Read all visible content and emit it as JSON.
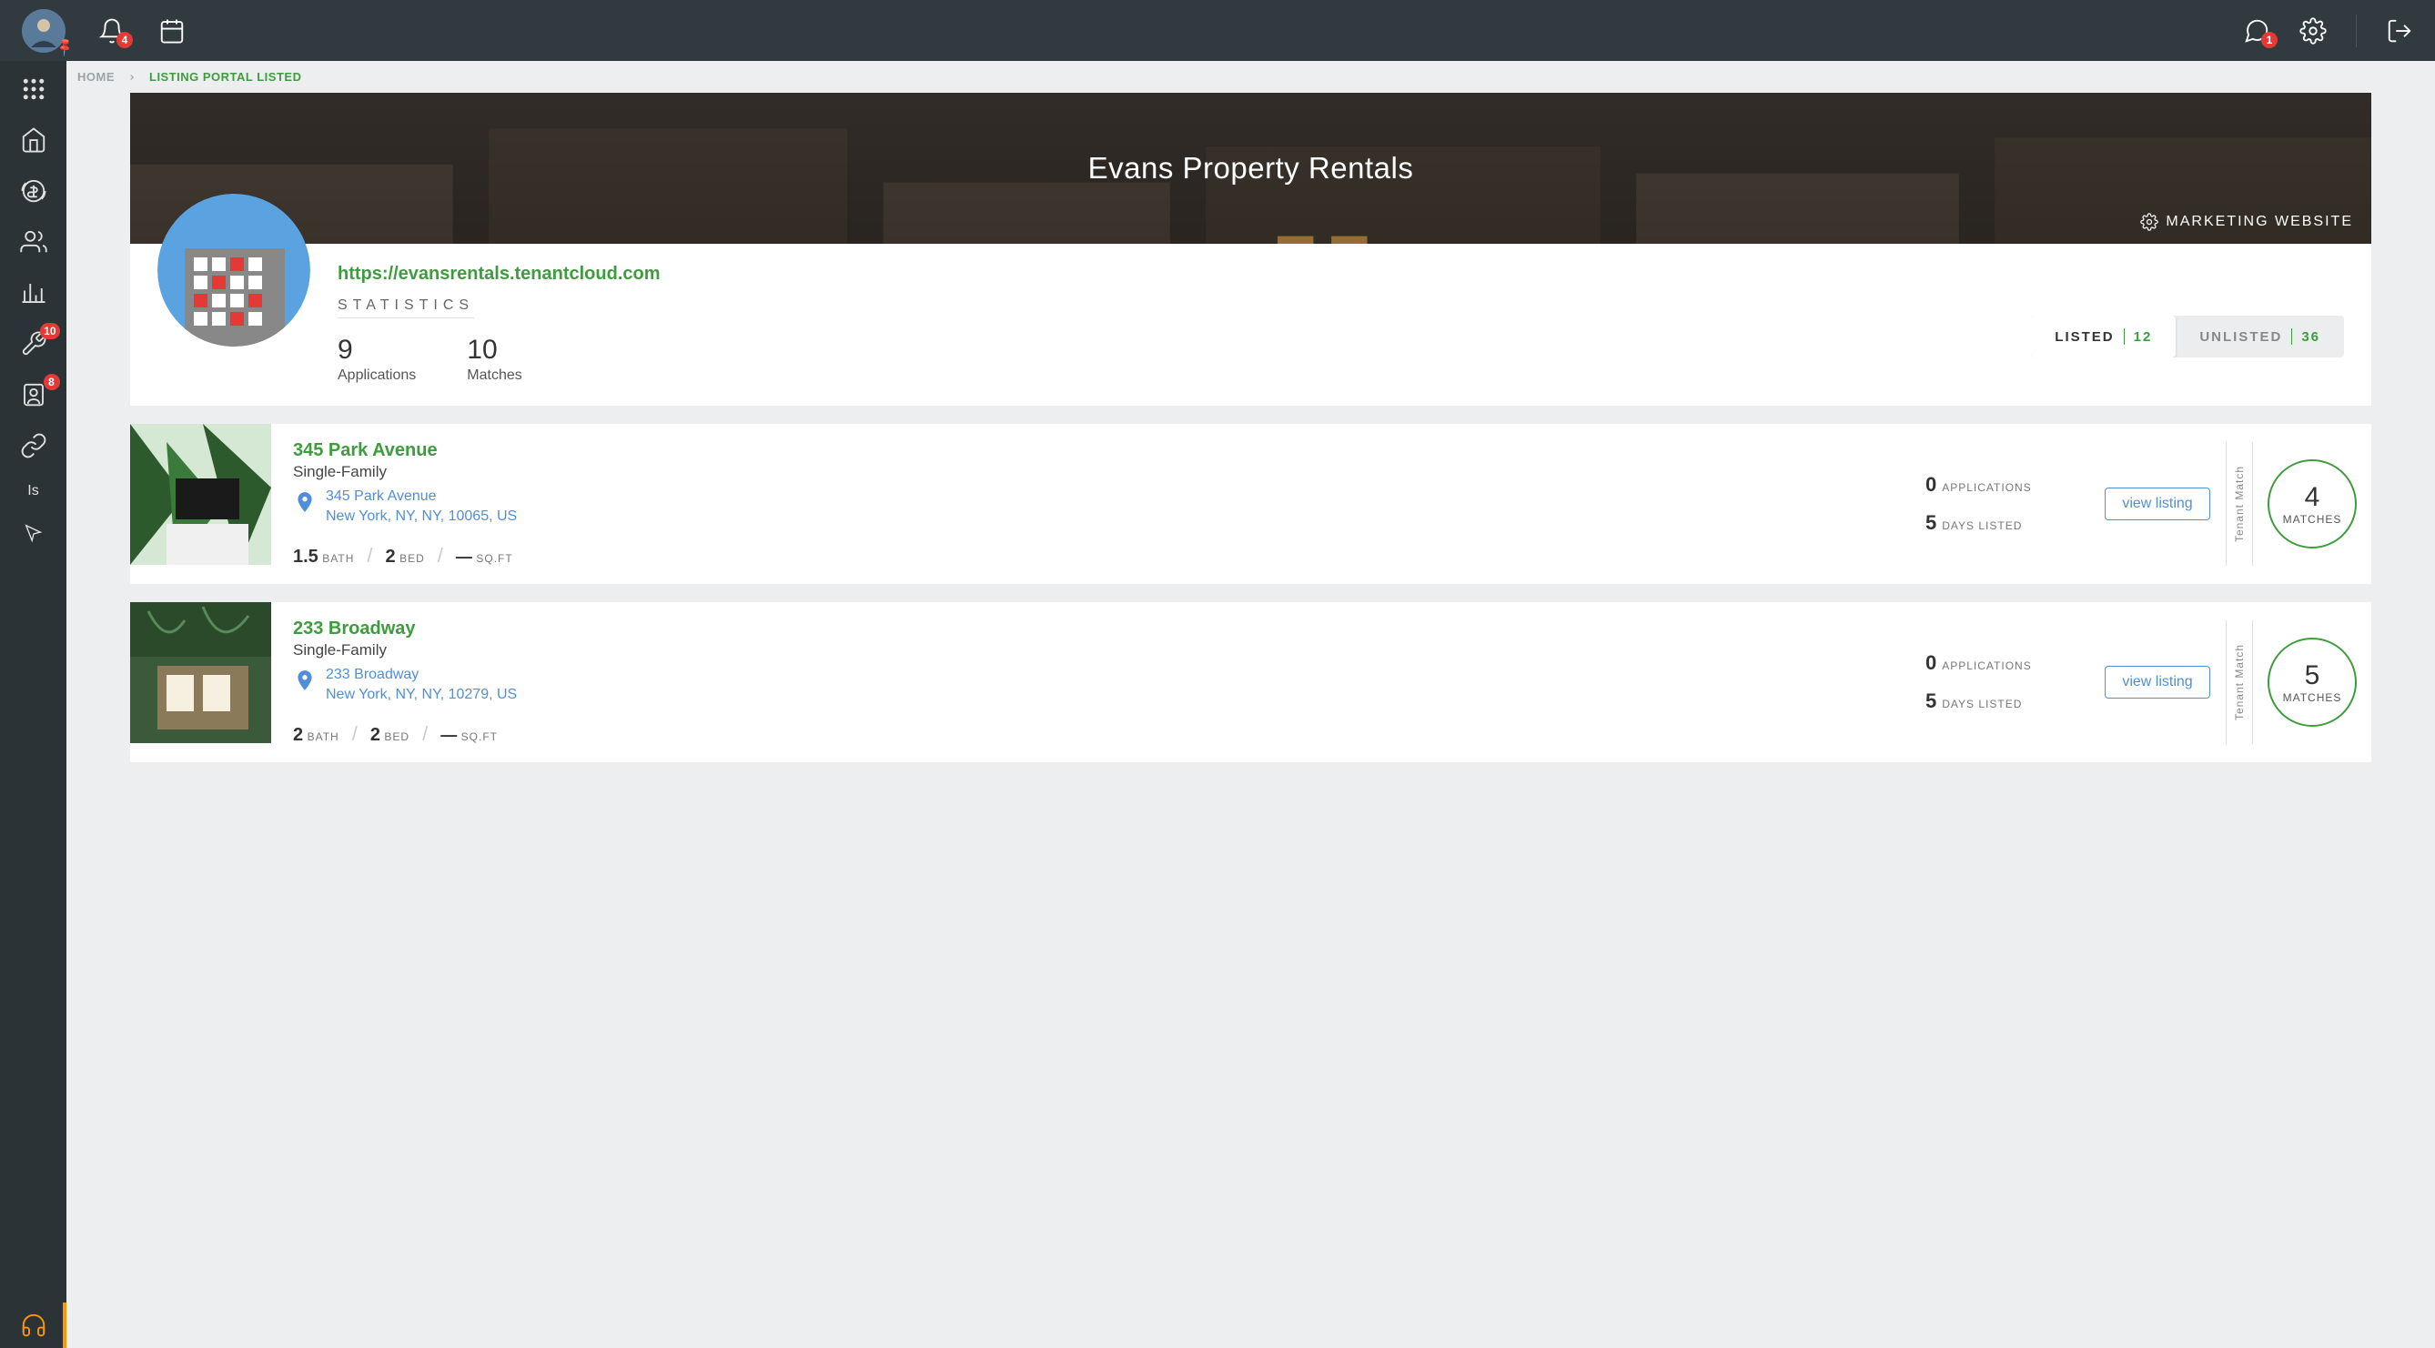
{
  "topbar": {
    "notification_badge": "4",
    "chat_badge": "1"
  },
  "sidebar": {
    "tools_badge": "10",
    "contacts_badge": "8",
    "text_item": "Is"
  },
  "breadcrumb": {
    "home": "HOME",
    "current": "LISTING PORTAL LISTED"
  },
  "hero": {
    "title": "Evans Property Rentals",
    "marketing_link": "MARKETING WEBSITE"
  },
  "portal": {
    "url": "https://evansrentals.tenantcloud.com",
    "stats_label": "STATISTICS",
    "applications_count": "9",
    "applications_label": "Applications",
    "matches_count": "10",
    "matches_label": "Matches"
  },
  "tabs": {
    "listed_label": "LISTED",
    "listed_count": "12",
    "unlisted_label": "UNLISTED",
    "unlisted_count": "36"
  },
  "labels": {
    "bath": "BATH",
    "bed": "BED",
    "sqft": "SQ.FT",
    "applications": "APPLICATIONS",
    "days_listed": "DAYS LISTED",
    "view_listing": "view listing",
    "tenant_match": "Tenant Match",
    "matches": "MATCHES"
  },
  "listings": [
    {
      "title": "345 Park Avenue",
      "type": "Single-Family",
      "address_line1": "345 Park Avenue",
      "address_line2": "New York, NY, NY, 10065, US",
      "bath": "1.5",
      "bed": "2",
      "sqft": "—",
      "applications": "0",
      "days_listed": "5",
      "matches": "4"
    },
    {
      "title": "233 Broadway",
      "type": "Single-Family",
      "address_line1": "233 Broadway",
      "address_line2": "New York, NY, NY, 10279, US",
      "bath": "2",
      "bed": "2",
      "sqft": "—",
      "applications": "0",
      "days_listed": "5",
      "matches": "5"
    }
  ]
}
